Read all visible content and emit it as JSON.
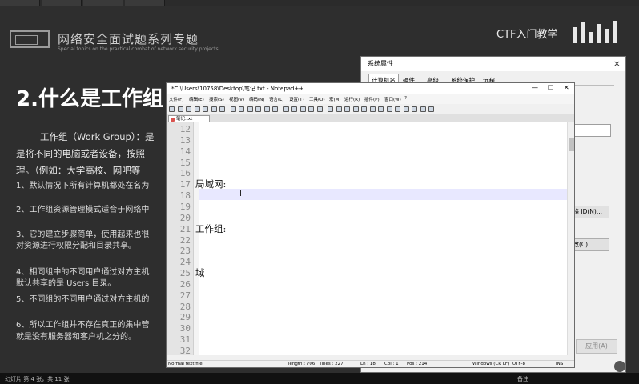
{
  "slide": {
    "title_cn": "网络安全面试题系列专题",
    "title_en": "Special topics on the practical combat of network security projects",
    "brand": "CTF入门教学",
    "heading": "2.什么是工作组",
    "para": [
      "工作组（Work Group）：是",
      "是将不同的电脑或者设备，按照",
      "理。（例如：大学高校、网吧等"
    ],
    "list": [
      "1、默认情况下所有计算机都处在名为",
      "2、工作组资源管理模式适合于网络中",
      "3、它的建立步骤简单，使用起来也很",
      "对资源进行权限分配和目录共享。",
      "4、相同组中的不同用户通过对方主机",
      "默认共享的是 Users 目录。",
      "5、不同组的不同用户通过对方主机的",
      "6、所以工作组并不存在真正的集中管",
      "就是没有服务器和客户机之分的。"
    ]
  },
  "statusbar": {
    "left": "幻灯片 第 4 张，共 11 张",
    "center": "备注"
  },
  "sysdlg": {
    "title": "系统属性",
    "close": "×",
    "tabs": [
      "计算机名",
      "硬件",
      "高级",
      "系统保护",
      "远程"
    ],
    "btn_network_id": "网络 ID(N)...",
    "btn_change": "更改(C)...",
    "apply": "应用(A)"
  },
  "npp": {
    "title": "*C:\\Users\\10758\\Desktop\\笔记.txt - Notepad++",
    "buttons": {
      "min": "—",
      "max": "☐",
      "close": "✕"
    },
    "menus": [
      "文件(F)",
      "编辑(E)",
      "搜索(S)",
      "视图(V)",
      "编码(N)",
      "语言(L)",
      "设置(T)",
      "工具(O)",
      "宏(M)",
      "运行(R)",
      "插件(P)",
      "窗口(W)",
      "?"
    ],
    "tab": "笔记.txt",
    "lines": [
      {
        "n": "12",
        "t": ""
      },
      {
        "n": "13",
        "t": ""
      },
      {
        "n": "14",
        "t": ""
      },
      {
        "n": "15",
        "t": ""
      },
      {
        "n": "16",
        "t": ""
      },
      {
        "n": "17",
        "t": "局域网:"
      },
      {
        "n": "18",
        "t": ""
      },
      {
        "n": "19",
        "t": ""
      },
      {
        "n": "20",
        "t": ""
      },
      {
        "n": "21",
        "t": "工作组:"
      },
      {
        "n": "22",
        "t": ""
      },
      {
        "n": "23",
        "t": ""
      },
      {
        "n": "24",
        "t": ""
      },
      {
        "n": "25",
        "t": "域"
      },
      {
        "n": "26",
        "t": ""
      },
      {
        "n": "27",
        "t": ""
      },
      {
        "n": "28",
        "t": ""
      },
      {
        "n": "29",
        "t": ""
      },
      {
        "n": "30",
        "t": ""
      },
      {
        "n": "31",
        "t": ""
      },
      {
        "n": "32",
        "t": ""
      }
    ],
    "current_line": "18",
    "status": {
      "type": "Normal text file",
      "length": "length : 706",
      "lines": "lines : 227",
      "ln": "Ln : 18",
      "col": "Col : 1",
      "pos": "Pos : 214",
      "eol": "Windows (CR LF)",
      "enc": "UTF-8",
      "ins": "INS"
    }
  }
}
